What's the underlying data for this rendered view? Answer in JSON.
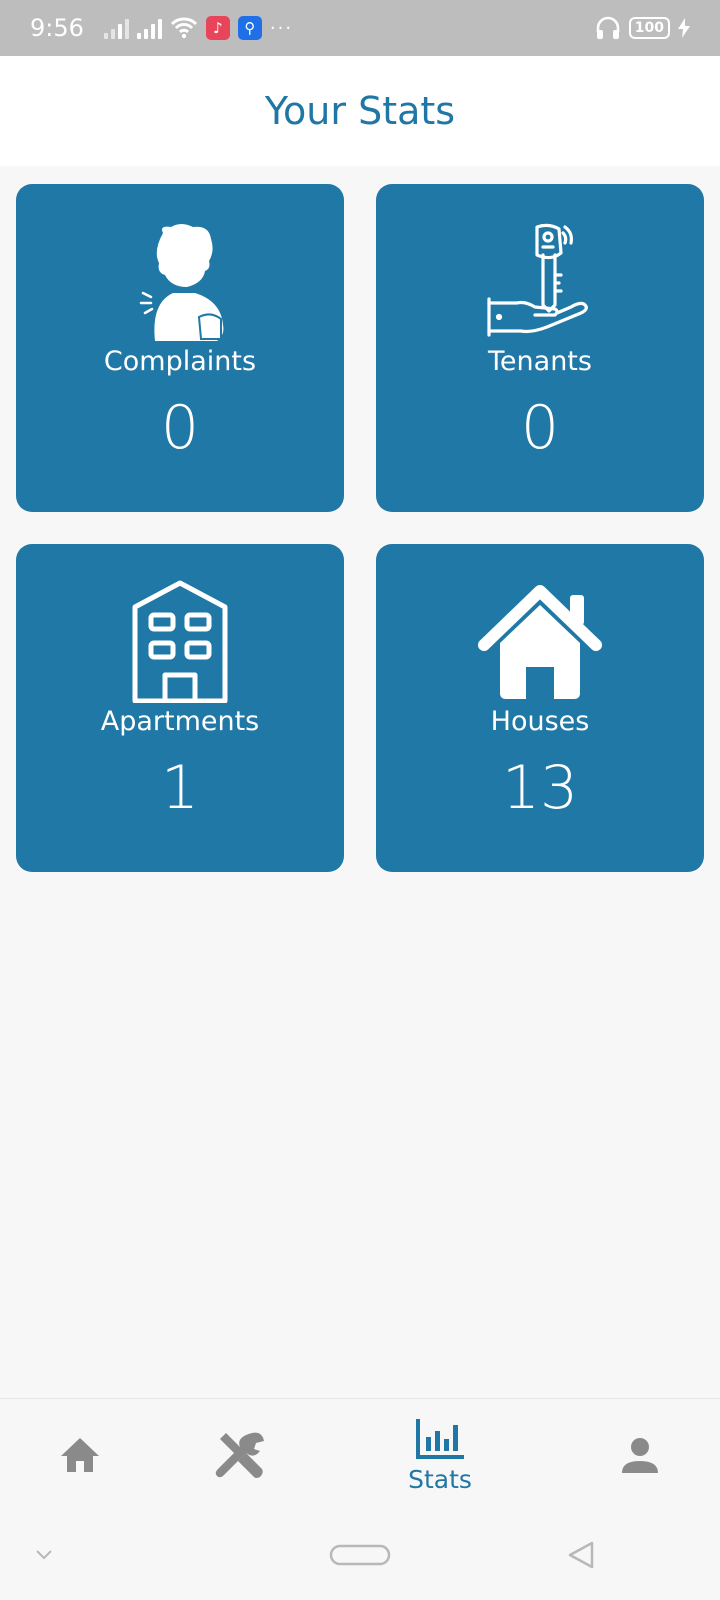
{
  "status_bar": {
    "time": "9:56",
    "battery": "100"
  },
  "header": {
    "title": "Your Stats"
  },
  "cards": [
    {
      "label": "Complaints",
      "value": "0",
      "icon": "complaint-person-icon"
    },
    {
      "label": "Tenants",
      "value": "0",
      "icon": "key-hand-icon"
    },
    {
      "label": "Apartments",
      "value": "1",
      "icon": "apartment-building-icon"
    },
    {
      "label": "Houses",
      "value": "13",
      "icon": "house-icon"
    }
  ],
  "bottom_nav": {
    "items": [
      {
        "icon": "home-icon"
      },
      {
        "icon": "tools-icon"
      },
      {
        "icon": "stats-icon",
        "label": "Stats",
        "active": true
      },
      {
        "icon": "person-icon"
      }
    ]
  },
  "colors": {
    "primary": "#1f77a6",
    "card": "#2078a7",
    "inactive": "#8a8a8a",
    "background": "#f7f7f7"
  }
}
